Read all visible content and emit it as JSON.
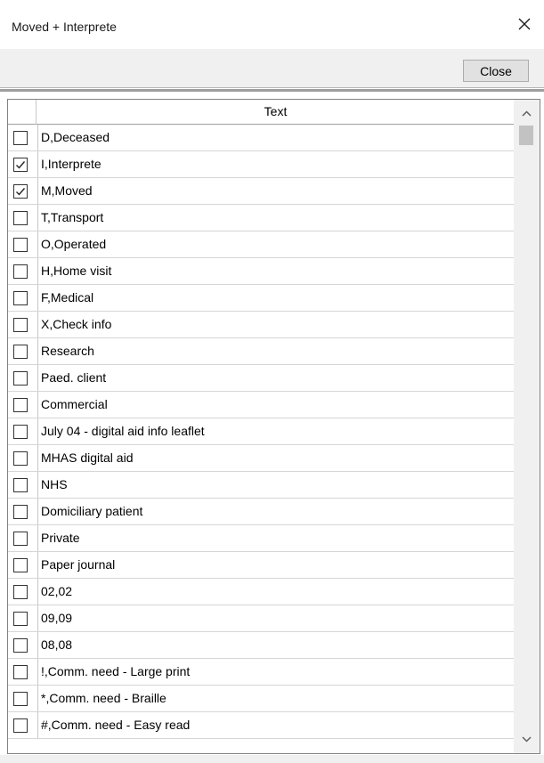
{
  "window": {
    "title": "Moved + Interprete"
  },
  "toolbar": {
    "close_label": "Close"
  },
  "grid": {
    "column_header": "Text",
    "rows": [
      {
        "label": "D,Deceased",
        "checked": false
      },
      {
        "label": "I,Interprete",
        "checked": true
      },
      {
        "label": "M,Moved",
        "checked": true
      },
      {
        "label": "T,Transport",
        "checked": false
      },
      {
        "label": "O,Operated",
        "checked": false
      },
      {
        "label": "H,Home visit",
        "checked": false
      },
      {
        "label": "F,Medical",
        "checked": false
      },
      {
        "label": "X,Check info",
        "checked": false
      },
      {
        "label": "Research",
        "checked": false
      },
      {
        "label": "Paed. client",
        "checked": false
      },
      {
        "label": "Commercial",
        "checked": false
      },
      {
        "label": "July 04 - digital aid info leaflet",
        "checked": false
      },
      {
        "label": "MHAS digital aid",
        "checked": false
      },
      {
        "label": "NHS",
        "checked": false
      },
      {
        "label": "Domiciliary patient",
        "checked": false
      },
      {
        "label": "Private",
        "checked": false
      },
      {
        "label": "Paper journal",
        "checked": false
      },
      {
        "label": "02,02",
        "checked": false
      },
      {
        "label": "09,09",
        "checked": false
      },
      {
        "label": "08,08",
        "checked": false
      },
      {
        "label": "!,Comm. need - Large print",
        "checked": false
      },
      {
        "label": "*,Comm. need - Braille",
        "checked": false
      },
      {
        "label": "#,Comm. need - Easy read",
        "checked": false
      }
    ]
  },
  "icons": {
    "close_window": "close-icon",
    "checkbox_check": "checkmark-icon",
    "scroll_up": "chevron-up-icon",
    "scroll_down": "chevron-down-icon"
  }
}
